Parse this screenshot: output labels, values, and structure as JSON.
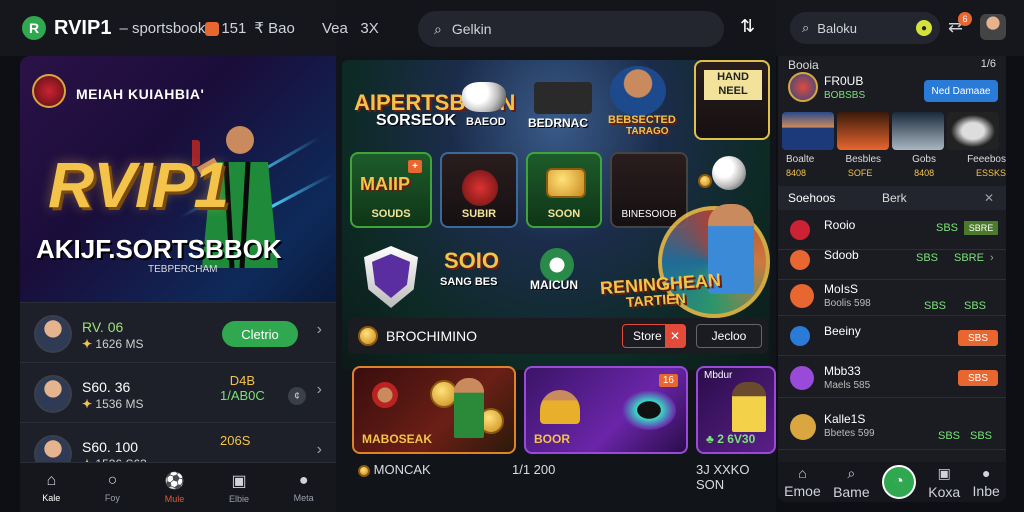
{
  "header": {
    "brand": "RVIP1",
    "tagline": "sportsbook",
    "code": "151",
    "item1": "Bao",
    "item2": "Vea",
    "item3": "3X"
  },
  "hero": {
    "caption": "MEIAH KUIAHBIA'",
    "big": "RVIP1",
    "subtitle": "AKIJF.SORTSBBOK",
    "tiny": "TEBPERCHAM"
  },
  "left_rows": [
    {
      "name": "RV. 06",
      "sub": "1626",
      "suffix": "MS",
      "action": "Cletrio"
    },
    {
      "name": "S60. 36",
      "sub": "1536",
      "suffix": "MS",
      "odds_top": "D4B",
      "odds_bottom": "1/AB0C"
    },
    {
      "name": "S60. 100",
      "sub": "1536",
      "suffix": "S63",
      "odds_top": "206S"
    }
  ],
  "bottom_nav": [
    {
      "label": "Kale",
      "icon": "home-icon"
    },
    {
      "label": "Foy",
      "icon": "circle-icon"
    },
    {
      "label": "Mule",
      "icon": "ball-icon"
    },
    {
      "label": "Elbie",
      "icon": "ticket-icon"
    },
    {
      "label": "Meta",
      "icon": "user-icon"
    }
  ],
  "center_search": {
    "placeholder": "Gelkin"
  },
  "center_games": {
    "title1": "AIPERTSBOON",
    "title1b": "SORSEOK",
    "t2": "BAEOD",
    "t3": "BEDRNAC",
    "t4": "BEBSECTED",
    "t4b": "TARAGO",
    "t5": "HAND",
    "t5b": "NEEL",
    "tile1": "SOUDS",
    "tile1b": "MAIIP",
    "tile2": "SUBIR",
    "tile3": "SOON",
    "tile4": "BINESOIOB",
    "lbl5": "SOIO",
    "lbl5b": "SANG BES",
    "lbl6": "MAICUN",
    "lbl7": "RENINGHEAN",
    "lbl7b": "TARTIEN"
  },
  "promo": {
    "text": "BROCHIMINO",
    "btn1": "Store",
    "btn2": "Jecloo"
  },
  "cards": [
    {
      "title": "MABOSEAK"
    },
    {
      "title": "BOOR",
      "badge": "16"
    },
    {
      "title": "2 6V30",
      "head": "Mbdur"
    }
  ],
  "center_footer": {
    "left": "MONCAK",
    "mid": "1/1 200",
    "right": "3J XXKO SON"
  },
  "right_top": {
    "search": "Baloku",
    "notif_count": "6"
  },
  "right_panel": {
    "header_left": "Booia",
    "header_right": "1/6",
    "team_title": "FR0UB",
    "team_sub": "BOBSBS",
    "cta": "Ned Damaae",
    "thumb_labels": [
      "Boalte",
      "Besbles",
      "Gobs",
      "Feeebos"
    ],
    "thumb_subs": [
      "8408",
      "SOFE",
      "8408",
      "ESSKS"
    ],
    "bar": {
      "a": "Soehoos",
      "b": "Berk"
    },
    "items": [
      {
        "t": "Rooio",
        "s": "",
        "v": "SBS",
        "g": "SBRE"
      },
      {
        "t": "Sdoob",
        "s": "",
        "v": "SBS",
        "g": "SBRE"
      },
      {
        "t": "MoIsS",
        "s": "Boolis 598",
        "v": "SBS",
        "g": "SBS"
      },
      {
        "t": "Beeiny",
        "s": "",
        "o": "SBS"
      },
      {
        "t": "Mbb33",
        "s": "Maels 585",
        "o": "SBS"
      },
      {
        "t": "Kalle1S",
        "s": "Bbetes 599",
        "v": "SBS",
        "g": "SBS"
      }
    ]
  },
  "right_nav": [
    {
      "label": "Emoe"
    },
    {
      "label": "Bame"
    },
    {
      "label": "Koxa"
    },
    {
      "label": "Inbe"
    }
  ]
}
